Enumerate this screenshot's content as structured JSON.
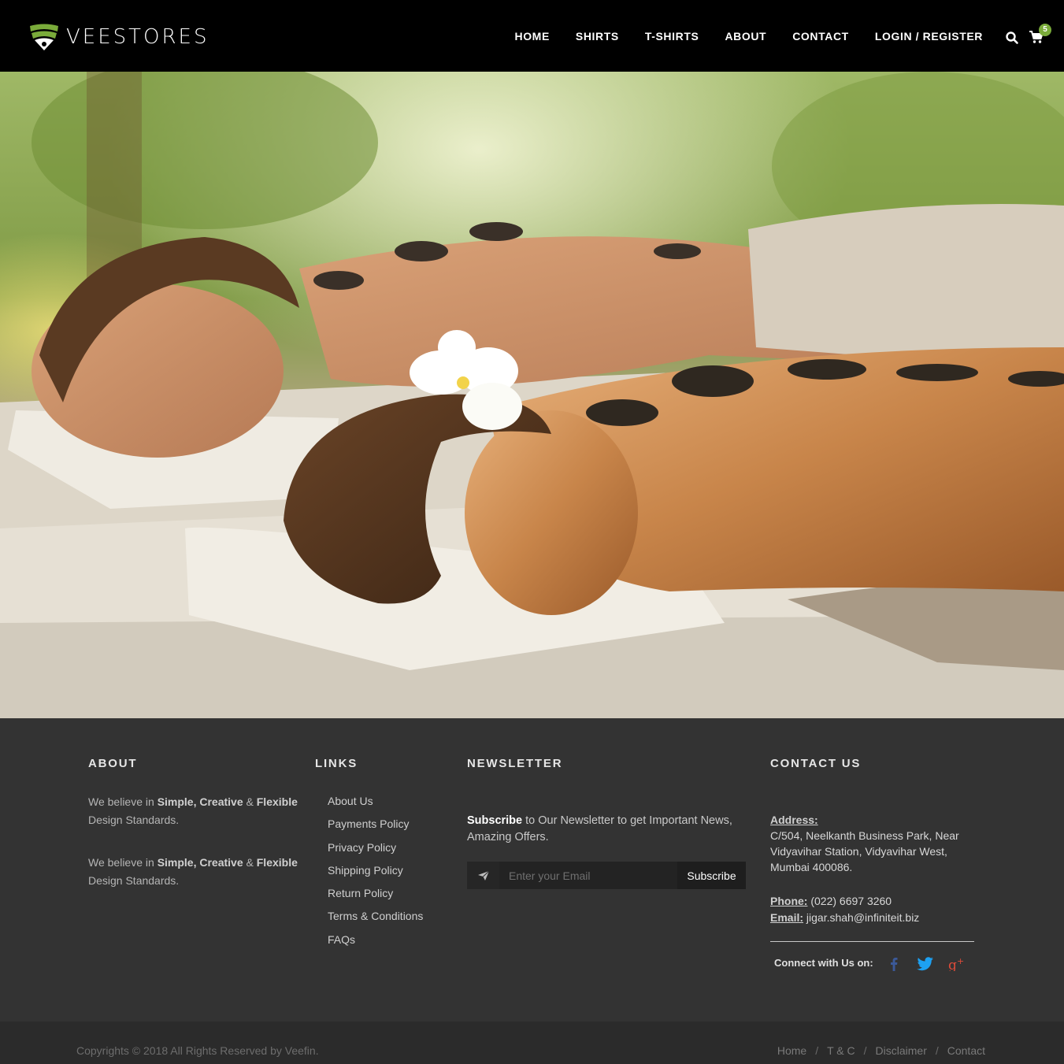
{
  "header": {
    "brand": "VEESTORES",
    "nav": [
      "HOME",
      "SHIRTS",
      "T-SHIRTS",
      "ABOUT",
      "CONTACT",
      "LOGIN / REGISTER"
    ],
    "cart_count": "5",
    "icons": [
      "search-icon",
      "cart-icon"
    ]
  },
  "hero": {
    "image": "spa-couple-hot-stone-massage"
  },
  "footer": {
    "about": {
      "title": "ABOUT",
      "para1_prefix": "We believe in ",
      "para1_b1": "Simple, Creative",
      "para1_amp": " & ",
      "para1_b2": "Flexible",
      "para1_suffix": "Design Standards.",
      "para2_prefix": "We believe in ",
      "para2_b1": "Simple, Creative",
      "para2_amp": " & ",
      "para2_b2": "Flexible",
      "para2_suffix": "Design Standards."
    },
    "links": {
      "title": "LINKS",
      "items": [
        "About Us",
        "Payments Policy",
        "Privacy Policy",
        "Shipping Policy",
        "Return Policy",
        "Terms & Conditions",
        "FAQs"
      ]
    },
    "newsletter": {
      "title": "NEWSLETTER",
      "text_bold": "Subscribe",
      "text_rest": " to Our Newsletter to get Important News, Amazing Offers.",
      "input_placeholder": "Enter your Email",
      "button": "Subscribe"
    },
    "contact": {
      "title": "CONTACT US",
      "address_label": "Address:",
      "address": "C/504, Neelkanth Business Park, Near Vidyavihar Station, Vidyavihar West, Mumbai 400086.",
      "phone_label": "Phone:",
      "phone": " (022) 6697 3260",
      "email_label": "Email:",
      "email": " jigar.shah@infiniteit.biz",
      "connect_label": "Connect with Us on:",
      "colors": {
        "facebook": "#3b5998",
        "twitter": "#1da1f2",
        "google": "#dd4b39"
      }
    }
  },
  "bottom": {
    "copyright": "Copyrights © 2018 All Rights Reserved by Veefin.",
    "links": [
      "Home",
      "T & C",
      "Disclaimer",
      "Contact"
    ]
  },
  "colors": {
    "accent": "#7aab3a",
    "header_bg": "#000000",
    "footer_bg": "#333333"
  }
}
